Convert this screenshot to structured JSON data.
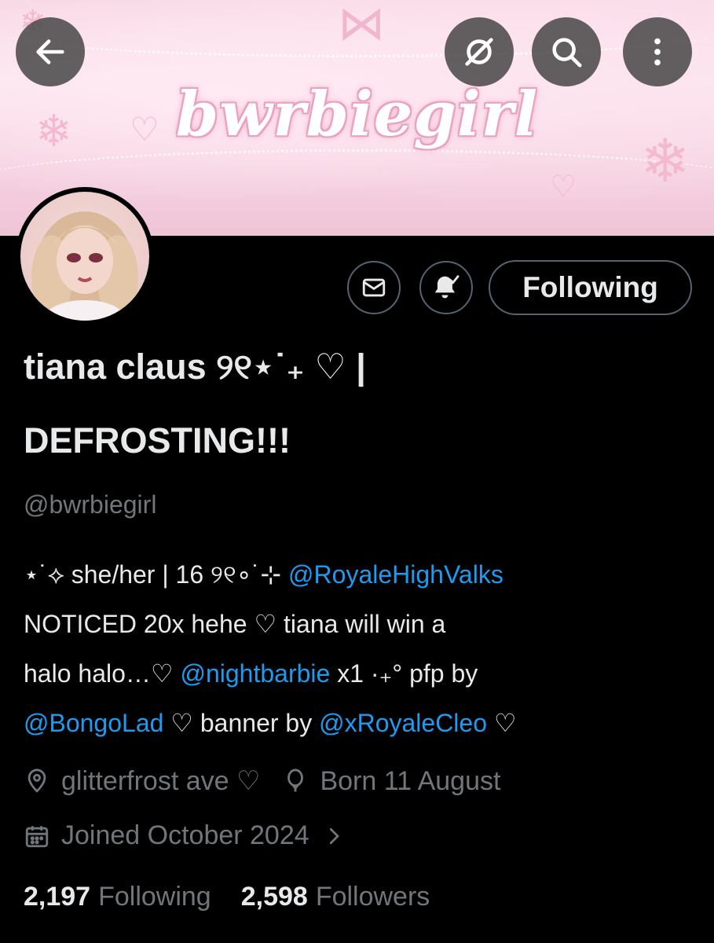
{
  "banner": {
    "title": "bwrbiegirl"
  },
  "top_bar": {
    "back_icon": "arrow-left-icon",
    "grok_icon": "slashed-circle-icon",
    "search_icon": "search-icon",
    "more_icon": "more-vertical-icon"
  },
  "actions": {
    "message_icon": "envelope-icon",
    "notify_icon": "bell-check-icon",
    "follow_label": "Following"
  },
  "profile": {
    "name_line1": "tiana claus ୨୧⋆˙₊ ♡ |",
    "name_line2": "DEFROSTING!!!",
    "handle": "@bwrbiegirl"
  },
  "bio": {
    "line1_text": "⋆˙⟡ she/her | 16 ୨୧∘˙⊹ ",
    "line1_link": "@RoyaleHighValks",
    "line2_text": "NOTICED 20x hehe ♡ tiana will win a",
    "line3_text_a": "halo halo…♡ ",
    "line3_link": "@nightbarbie",
    "line3_text_b": " x1 ·₊° pfp by",
    "line4_link_a": "@BongoLad",
    "line4_text": " ♡ banner by ",
    "line4_link_b": "@xRoyaleCleo",
    "line4_end": " ♡"
  },
  "meta": {
    "location": "glitterfrost ave ♡",
    "birthday": "Born 11 August",
    "joined": "Joined October 2024"
  },
  "stats": {
    "following_count": "2,197",
    "following_label": "Following",
    "followers_count": "2,598",
    "followers_label": "Followers"
  },
  "colors": {
    "background": "#000000",
    "text": "#e7e9ea",
    "muted": "#71767b",
    "link": "#1d9bf0",
    "border": "#536471"
  }
}
